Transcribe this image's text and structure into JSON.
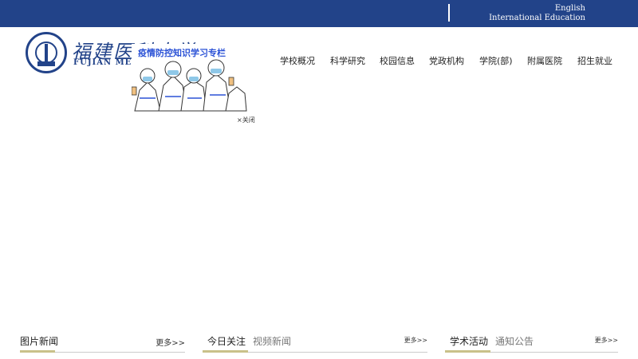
{
  "topbar": {
    "english": "English",
    "international": "International Education",
    "bg_color": "#224389"
  },
  "logo": {
    "cn_name": "福建医科大学",
    "en_name": "FUJIAN ME"
  },
  "nav": {
    "items": [
      "学校概况",
      "科学研究",
      "校园信息",
      "党政机构",
      "学院(部)",
      "附属医院",
      "招生就业"
    ]
  },
  "float_ad": {
    "title": "疫情防控知识学习专栏",
    "close_label": "×关闭"
  },
  "sections": [
    {
      "tabs": [
        "图片新闻"
      ],
      "more": "更多>>"
    },
    {
      "tabs": [
        "今日关注",
        "视频新闻"
      ],
      "more": "更多>>"
    },
    {
      "tabs": [
        "学术活动",
        "通知公告"
      ],
      "more": "更多>>"
    }
  ],
  "colors": {
    "accent": "#c9c18a",
    "brand": "#224389",
    "ad_title": "#2b52d6"
  }
}
